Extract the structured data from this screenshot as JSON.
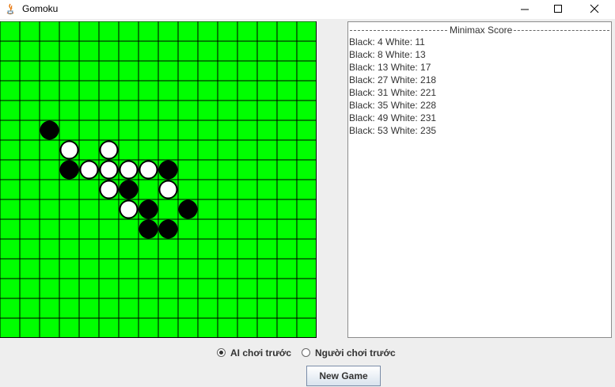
{
  "window": {
    "title": "Gomoku"
  },
  "board": {
    "rows": 16,
    "cols": 16,
    "background_color": "#00ff00",
    "grid_color": "#000000",
    "stones": [
      {
        "color": "black",
        "row": 5,
        "col": 2
      },
      {
        "color": "white",
        "row": 6,
        "col": 3
      },
      {
        "color": "white",
        "row": 6,
        "col": 5
      },
      {
        "color": "black",
        "row": 7,
        "col": 3
      },
      {
        "color": "white",
        "row": 7,
        "col": 4
      },
      {
        "color": "white",
        "row": 7,
        "col": 5
      },
      {
        "color": "white",
        "row": 7,
        "col": 6
      },
      {
        "color": "white",
        "row": 7,
        "col": 7
      },
      {
        "color": "black",
        "row": 7,
        "col": 8
      },
      {
        "color": "white",
        "row": 8,
        "col": 5
      },
      {
        "color": "black",
        "row": 8,
        "col": 6
      },
      {
        "color": "white",
        "row": 8,
        "col": 8
      },
      {
        "color": "white",
        "row": 9,
        "col": 6
      },
      {
        "color": "black",
        "row": 9,
        "col": 7
      },
      {
        "color": "black",
        "row": 9,
        "col": 9
      },
      {
        "color": "black",
        "row": 10,
        "col": 7
      },
      {
        "color": "black",
        "row": 10,
        "col": 8
      }
    ]
  },
  "score_panel": {
    "title": "Minimax Score",
    "lines": [
      "Black: 4 White: 11",
      "Black: 8 White: 13",
      "Black: 13 White: 17",
      "Black: 27 White: 218",
      "Black: 31 White: 221",
      "Black: 35 White: 228",
      "Black: 49 White: 231",
      "Black: 53 White: 235"
    ]
  },
  "options": {
    "ai_first_label": "AI chơi trước",
    "human_first_label": "Người chơi trước",
    "selected": "ai_first"
  },
  "new_game_label": "New Game"
}
